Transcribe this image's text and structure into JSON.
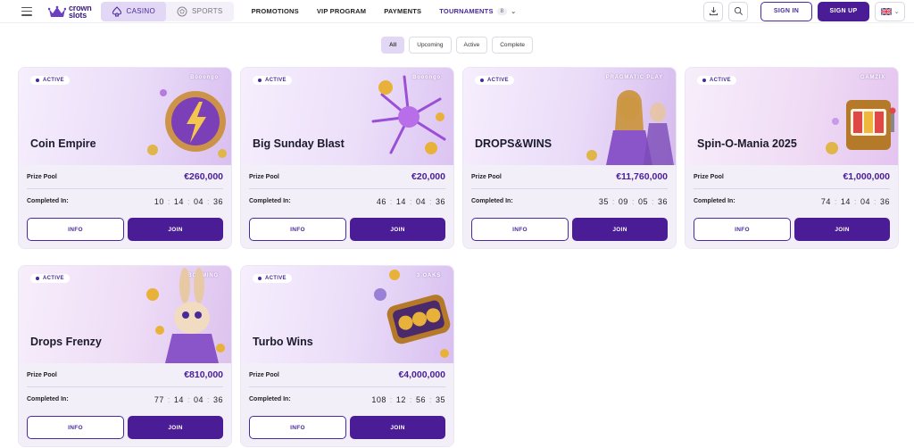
{
  "header": {
    "logo_line1": "crown",
    "logo_line2": "slots",
    "tabs": [
      {
        "label": "CASINO",
        "icon": "spade-icon"
      },
      {
        "label": "SPORTS",
        "icon": "soccer-ball-icon"
      }
    ],
    "nav": [
      {
        "label": "PROMOTIONS"
      },
      {
        "label": "VIP PROGRAM"
      },
      {
        "label": "PAYMENTS"
      },
      {
        "label": "TOURNAMENTS",
        "badge": "8"
      }
    ],
    "signin_label": "SIGN IN",
    "signup_label": "SIGN UP",
    "language_icon": "uk-flag-icon"
  },
  "filters": [
    "All",
    "Upcoming",
    "Active",
    "Complete"
  ],
  "labels": {
    "prize_pool": "Prize Pool",
    "completed_in": "Completed In:",
    "info": "INFO",
    "join": "JOIN"
  },
  "tournaments": [
    {
      "status": "ACTIVE",
      "title": "Coin Empire",
      "provider": "Booongo",
      "prize": "€260,000",
      "timer": [
        "10",
        "14",
        "04",
        "36"
      ]
    },
    {
      "status": "ACTIVE",
      "title": "Big Sunday Blast",
      "provider": "Booongo",
      "prize": "€20,000",
      "timer": [
        "46",
        "14",
        "04",
        "36"
      ]
    },
    {
      "status": "ACTIVE",
      "title": "DROPS&WINS",
      "provider": "PRAGMATIC PLAY",
      "prize": "€11,760,000",
      "timer": [
        "35",
        "09",
        "05",
        "36"
      ]
    },
    {
      "status": "ACTIVE",
      "title": "Spin-O-Mania 2025",
      "provider": "GAMZIX",
      "prize": "€1,000,000",
      "timer": [
        "74",
        "14",
        "04",
        "36"
      ]
    },
    {
      "status": "ACTIVE",
      "title": "Drops Frenzy",
      "provider": "BGAMING",
      "prize": "€810,000",
      "timer": [
        "77",
        "14",
        "04",
        "36"
      ]
    },
    {
      "status": "ACTIVE",
      "title": "Turbo Wins",
      "provider": "3 OAKS",
      "prize": "€4,000,000",
      "timer": [
        "108",
        "12",
        "56",
        "35"
      ]
    }
  ],
  "colors": {
    "brand": "#4a1d96",
    "accent_light": "#e2d8f6",
    "card_bg": "#f2eff9"
  }
}
